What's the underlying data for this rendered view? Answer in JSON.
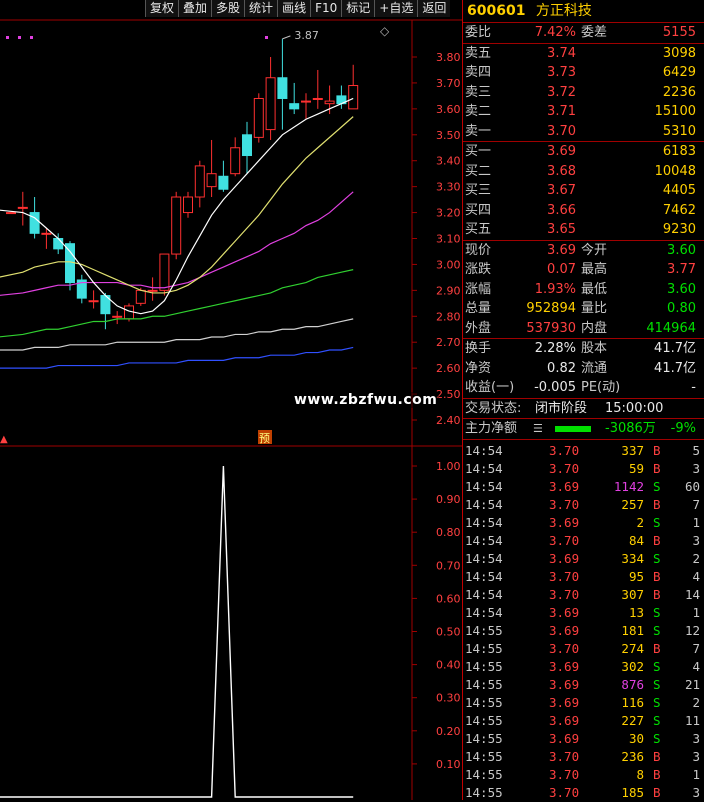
{
  "toolbar": [
    "复权",
    "叠加",
    "多股",
    "统计",
    "画线",
    "F10",
    "标记",
    "+自选",
    "返回"
  ],
  "chart": {
    "peak_label": "3.87",
    "yu_tag": "预",
    "price_axis": [
      "3.80",
      "3.70",
      "3.60",
      "3.50",
      "3.40",
      "3.30",
      "3.20",
      "3.10",
      "3.00",
      "2.90",
      "2.80",
      "2.70",
      "2.60",
      "2.50",
      "2.40"
    ],
    "indicator_axis": [
      "1.00",
      "0.90",
      "0.80",
      "0.70",
      "0.60",
      "0.50",
      "0.40",
      "0.30",
      "0.20",
      "0.10"
    ],
    "colors": {
      "up": "#ff3030",
      "down": "#40e0e0",
      "ma5": "#ffffff",
      "ma10": "#e0e070",
      "ma20": "#e040e0",
      "ma60": "#30d030",
      "ma120": "#d0d0d0",
      "ma250": "#3050ff"
    }
  },
  "watermark": "www.zbzfwu.com",
  "stock": {
    "code": "600601",
    "name": "方正科技"
  },
  "weibi": {
    "label1": "委比",
    "val1": "7.42%",
    "label2": "委差",
    "val2": "5155"
  },
  "asks": [
    {
      "label": "卖五",
      "price": "3.74",
      "vol": "3098"
    },
    {
      "label": "卖四",
      "price": "3.73",
      "vol": "6429"
    },
    {
      "label": "卖三",
      "price": "3.72",
      "vol": "2236"
    },
    {
      "label": "卖二",
      "price": "3.71",
      "vol": "15100"
    },
    {
      "label": "卖一",
      "price": "3.70",
      "vol": "5310"
    }
  ],
  "bids": [
    {
      "label": "买一",
      "price": "3.69",
      "vol": "6183"
    },
    {
      "label": "买二",
      "price": "3.68",
      "vol": "10048"
    },
    {
      "label": "买三",
      "price": "3.67",
      "vol": "4405"
    },
    {
      "label": "买四",
      "price": "3.66",
      "vol": "7462"
    },
    {
      "label": "买五",
      "price": "3.65",
      "vol": "9230"
    }
  ],
  "quote": [
    {
      "l1": "现价",
      "v1": "3.69",
      "l2": "今开",
      "v2": "3.60"
    },
    {
      "l1": "涨跌",
      "v1": "0.07",
      "l2": "最高",
      "v2": "3.77"
    },
    {
      "l1": "涨幅",
      "v1": "1.93%",
      "l2": "最低",
      "v2": "3.60"
    },
    {
      "l1": "总量",
      "v1": "952894",
      "l2": "量比",
      "v2": "0.80"
    },
    {
      "l1": "外盘",
      "v1": "537930",
      "l2": "内盘",
      "v2": "414964"
    }
  ],
  "fin": [
    {
      "l1": "换手",
      "v1": "2.28%",
      "l2": "股本",
      "v2": "41.7亿"
    },
    {
      "l1": "净资",
      "v1": "0.82",
      "l2": "流通",
      "v2": "41.7亿"
    },
    {
      "l1": "收益(一)",
      "v1": "-0.005",
      "l2": "PE(动)",
      "v2": "-"
    }
  ],
  "trade_status": {
    "label": "交易状态:",
    "value": "闭市阶段",
    "time": "15:00:00"
  },
  "zhuli": {
    "label": "主力净额",
    "value": "-3086万",
    "pct": "-9%"
  },
  "ticks": [
    {
      "t": "14:54",
      "p": "3.70",
      "v": "337",
      "bs": "B",
      "n": "5"
    },
    {
      "t": "14:54",
      "p": "3.70",
      "v": "59",
      "bs": "B",
      "n": "3"
    },
    {
      "t": "14:54",
      "p": "3.69",
      "v": "1142",
      "bs": "S",
      "n": "60"
    },
    {
      "t": "14:54",
      "p": "3.70",
      "v": "257",
      "bs": "B",
      "n": "7"
    },
    {
      "t": "14:54",
      "p": "3.69",
      "v": "2",
      "bs": "S",
      "n": "1"
    },
    {
      "t": "14:54",
      "p": "3.70",
      "v": "84",
      "bs": "B",
      "n": "3"
    },
    {
      "t": "14:54",
      "p": "3.69",
      "v": "334",
      "bs": "S",
      "n": "2"
    },
    {
      "t": "14:54",
      "p": "3.70",
      "v": "95",
      "bs": "B",
      "n": "4"
    },
    {
      "t": "14:54",
      "p": "3.70",
      "v": "307",
      "bs": "B",
      "n": "14"
    },
    {
      "t": "14:54",
      "p": "3.69",
      "v": "13",
      "bs": "S",
      "n": "1"
    },
    {
      "t": "14:55",
      "p": "3.69",
      "v": "181",
      "bs": "S",
      "n": "12"
    },
    {
      "t": "14:55",
      "p": "3.70",
      "v": "274",
      "bs": "B",
      "n": "7"
    },
    {
      "t": "14:55",
      "p": "3.69",
      "v": "302",
      "bs": "S",
      "n": "4"
    },
    {
      "t": "14:55",
      "p": "3.69",
      "v": "876",
      "bs": "S",
      "n": "21"
    },
    {
      "t": "14:55",
      "p": "3.69",
      "v": "116",
      "bs": "S",
      "n": "2"
    },
    {
      "t": "14:55",
      "p": "3.69",
      "v": "227",
      "bs": "S",
      "n": "11"
    },
    {
      "t": "14:55",
      "p": "3.69",
      "v": "30",
      "bs": "S",
      "n": "3"
    },
    {
      "t": "14:55",
      "p": "3.70",
      "v": "236",
      "bs": "B",
      "n": "3"
    },
    {
      "t": "14:55",
      "p": "3.70",
      "v": "8",
      "bs": "B",
      "n": "1"
    },
    {
      "t": "14:55",
      "p": "3.70",
      "v": "185",
      "bs": "B",
      "n": "3"
    }
  ],
  "chart_data": {
    "type": "candlestick",
    "price_ylim": [
      2.35,
      3.85
    ],
    "candles": [
      {
        "o": 3.2,
        "h": 3.2,
        "l": 3.2,
        "c": 3.2
      },
      {
        "o": 3.22,
        "h": 3.28,
        "l": 3.15,
        "c": 3.22
      },
      {
        "o": 3.2,
        "h": 3.26,
        "l": 3.1,
        "c": 3.12
      },
      {
        "o": 3.12,
        "h": 3.14,
        "l": 3.06,
        "c": 3.12
      },
      {
        "o": 3.1,
        "h": 3.12,
        "l": 3.04,
        "c": 3.06
      },
      {
        "o": 3.08,
        "h": 3.09,
        "l": 2.9,
        "c": 2.93
      },
      {
        "o": 2.94,
        "h": 2.96,
        "l": 2.85,
        "c": 2.87
      },
      {
        "o": 2.86,
        "h": 2.9,
        "l": 2.83,
        "c": 2.86
      },
      {
        "o": 2.88,
        "h": 2.89,
        "l": 2.75,
        "c": 2.81
      },
      {
        "o": 2.8,
        "h": 2.82,
        "l": 2.77,
        "c": 2.8
      },
      {
        "o": 2.79,
        "h": 2.85,
        "l": 2.78,
        "c": 2.84
      },
      {
        "o": 2.85,
        "h": 2.91,
        "l": 2.84,
        "c": 2.9
      },
      {
        "o": 2.9,
        "h": 2.95,
        "l": 2.86,
        "c": 2.9
      },
      {
        "o": 2.9,
        "h": 3.04,
        "l": 2.88,
        "c": 3.04
      },
      {
        "o": 3.04,
        "h": 3.28,
        "l": 3.02,
        "c": 3.26
      },
      {
        "o": 3.2,
        "h": 3.28,
        "l": 3.18,
        "c": 3.26
      },
      {
        "o": 3.26,
        "h": 3.4,
        "l": 3.22,
        "c": 3.38
      },
      {
        "o": 3.3,
        "h": 3.48,
        "l": 3.26,
        "c": 3.35
      },
      {
        "o": 3.34,
        "h": 3.4,
        "l": 3.28,
        "c": 3.29
      },
      {
        "o": 3.35,
        "h": 3.49,
        "l": 3.34,
        "c": 3.45
      },
      {
        "o": 3.5,
        "h": 3.55,
        "l": 3.35,
        "c": 3.42
      },
      {
        "o": 3.49,
        "h": 3.66,
        "l": 3.47,
        "c": 3.64
      },
      {
        "o": 3.52,
        "h": 3.8,
        "l": 3.48,
        "c": 3.72
      },
      {
        "o": 3.72,
        "h": 3.87,
        "l": 3.52,
        "c": 3.64
      },
      {
        "o": 3.62,
        "h": 3.7,
        "l": 3.58,
        "c": 3.6
      },
      {
        "o": 3.63,
        "h": 3.66,
        "l": 3.56,
        "c": 3.63
      },
      {
        "o": 3.64,
        "h": 3.75,
        "l": 3.6,
        "c": 3.64
      },
      {
        "o": 3.62,
        "h": 3.69,
        "l": 3.58,
        "c": 3.63
      },
      {
        "o": 3.65,
        "h": 3.69,
        "l": 3.6,
        "c": 3.62
      },
      {
        "o": 3.6,
        "h": 3.77,
        "l": 3.6,
        "c": 3.69
      }
    ],
    "ma": {
      "ma5": [
        3.21,
        3.2,
        3.18,
        3.14,
        3.1,
        3.05,
        2.99,
        2.93,
        2.88,
        2.84,
        2.82,
        2.81,
        2.82,
        2.86,
        2.94,
        3.03,
        3.11,
        3.19,
        3.25,
        3.3,
        3.35,
        3.4,
        3.45,
        3.5,
        3.53,
        3.56,
        3.58,
        3.6,
        3.62,
        3.64
      ],
      "ma10": [
        2.95,
        2.97,
        2.99,
        3.0,
        3.01,
        3.01,
        3.0,
        2.98,
        2.96,
        2.94,
        2.92,
        2.9,
        2.89,
        2.89,
        2.9,
        2.92,
        2.95,
        2.99,
        3.04,
        3.09,
        3.14,
        3.19,
        3.25,
        3.31,
        3.36,
        3.41,
        3.45,
        3.49,
        3.53,
        3.57
      ],
      "ma20": [
        2.88,
        2.89,
        2.9,
        2.91,
        2.92,
        2.92,
        2.93,
        2.93,
        2.93,
        2.93,
        2.92,
        2.92,
        2.91,
        2.91,
        2.92,
        2.93,
        2.95,
        2.97,
        2.99,
        3.01,
        3.03,
        3.05,
        3.08,
        3.1,
        3.12,
        3.15,
        3.17,
        3.2,
        3.24,
        3.28
      ],
      "ma60": [
        2.72,
        2.73,
        2.74,
        2.75,
        2.75,
        2.76,
        2.77,
        2.78,
        2.78,
        2.79,
        2.79,
        2.79,
        2.8,
        2.8,
        2.81,
        2.82,
        2.83,
        2.84,
        2.85,
        2.86,
        2.87,
        2.88,
        2.89,
        2.91,
        2.92,
        2.93,
        2.95,
        2.96,
        2.97,
        2.98
      ],
      "ma120": [
        2.67,
        2.67,
        2.68,
        2.68,
        2.68,
        2.69,
        2.69,
        2.69,
        2.69,
        2.7,
        2.7,
        2.7,
        2.7,
        2.7,
        2.71,
        2.71,
        2.71,
        2.72,
        2.72,
        2.73,
        2.73,
        2.74,
        2.74,
        2.75,
        2.75,
        2.76,
        2.76,
        2.77,
        2.78,
        2.79
      ],
      "ma250": [
        2.6,
        2.6,
        2.6,
        2.6,
        2.61,
        2.61,
        2.61,
        2.61,
        2.61,
        2.61,
        2.62,
        2.62,
        2.62,
        2.62,
        2.62,
        2.63,
        2.63,
        2.63,
        2.63,
        2.64,
        2.64,
        2.64,
        2.65,
        2.65,
        2.65,
        2.66,
        2.66,
        2.67,
        2.67,
        2.68
      ]
    },
    "indicator": {
      "ylim": [
        0,
        1.06
      ],
      "values": [
        0,
        0,
        0,
        0,
        0,
        0,
        0,
        0,
        0,
        0,
        0,
        0,
        0,
        0,
        0,
        0,
        0,
        0,
        1,
        0,
        0,
        0,
        0,
        0,
        0,
        0,
        0,
        0,
        0,
        0
      ]
    }
  }
}
